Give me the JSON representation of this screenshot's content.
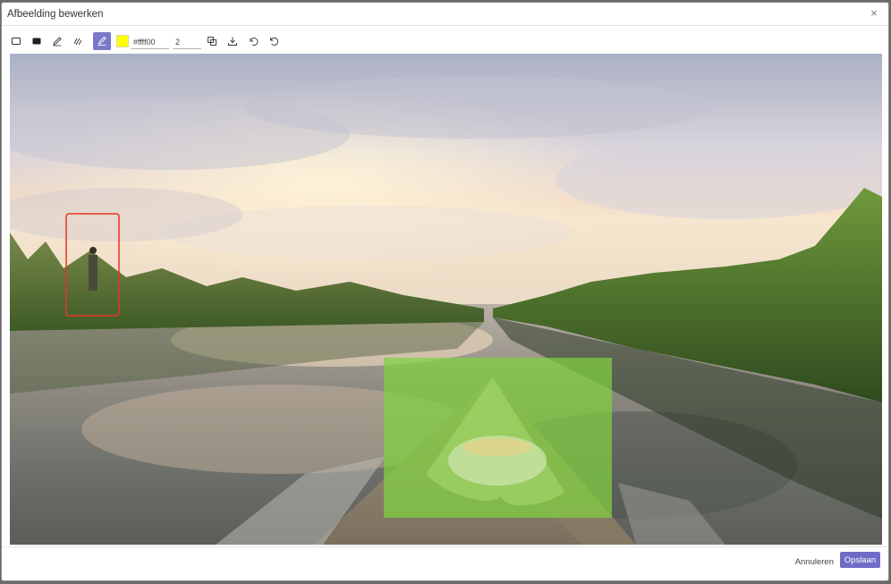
{
  "dialog": {
    "title": "Afbeelding bewerken",
    "close_glyph": "×"
  },
  "toolbar": {
    "tools": [
      {
        "name": "rectangle-outline-tool",
        "icon": "rectangle-outline-icon"
      },
      {
        "name": "rectangle-filled-tool",
        "icon": "rectangle-filled-icon"
      },
      {
        "name": "pencil-tool",
        "icon": "pencil-icon"
      },
      {
        "name": "freehand-tool",
        "icon": "freehand-icon"
      },
      {
        "name": "highlighter-tool",
        "icon": "highlighter-icon",
        "active": true
      }
    ],
    "color_value": "#ffff00",
    "color_text": "#ffff00",
    "stroke_width": "2",
    "actions": [
      {
        "name": "crop-button",
        "icon": "crop-icon"
      },
      {
        "name": "download-button",
        "icon": "download-icon"
      },
      {
        "name": "undo-button",
        "icon": "undo-icon"
      },
      {
        "name": "reset-button",
        "icon": "reset-icon"
      }
    ]
  },
  "annotations": {
    "rect_color": "#e8322a",
    "highlight_color": "#7fd140"
  },
  "footer": {
    "cancel_label": "Annuleren",
    "save_label": "Opslaan"
  },
  "colors": {
    "accent": "#6e6cc7",
    "active_tool": "#7b78c9"
  }
}
